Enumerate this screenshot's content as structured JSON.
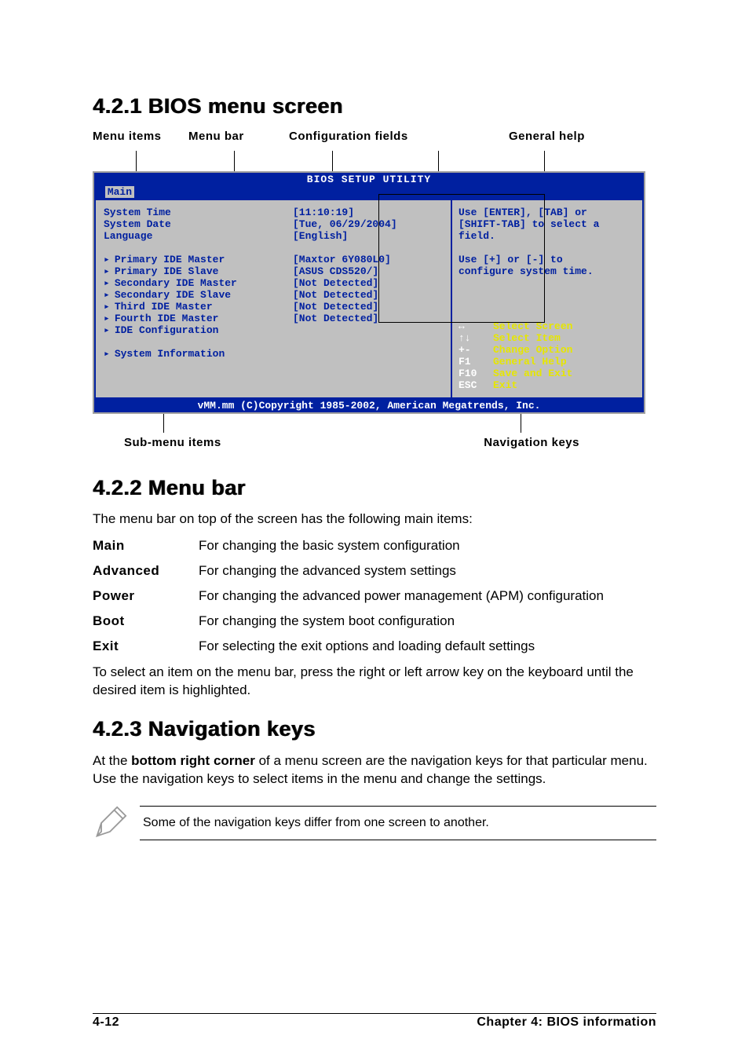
{
  "section1": {
    "heading": "4.2.1   BIOS menu screen"
  },
  "callouts": {
    "menu_items": "Menu items",
    "menu_bar": "Menu bar",
    "config_fields": "Configuration fields",
    "general_help": "General help",
    "submenu_items": "Sub-menu items",
    "nav_keys": "Navigation keys"
  },
  "bios": {
    "title": "BIOS SETUP UTILITY",
    "tab": "Main",
    "left": {
      "l1": "System Time",
      "l2": "System Date",
      "l3": "Language",
      "l4": "Primary IDE Master",
      "l5": "Primary IDE Slave",
      "l6": "Secondary IDE Master",
      "l7": "Secondary IDE Slave",
      "l8": "Third IDE Master",
      "l9": "Fourth IDE Master",
      "l10": "IDE Configuration",
      "l11": "System Information"
    },
    "mid": {
      "m1": "[11:10:19]",
      "m2": "[Tue, 06/29/2004]",
      "m3": "[English]",
      "m4": "[Maxtor 6Y080L0]",
      "m5": "[ASUS CDS520/]",
      "m6": "[Not Detected]",
      "m7": "[Not Detected]",
      "m8": "[Not Detected]",
      "m9": "[Not Detected]"
    },
    "help": {
      "h1": "Use [ENTER], [TAB] or",
      "h2": "[SHIFT-TAB] to select a",
      "h3": "field.",
      "h4": "Use [+] or [-] to",
      "h5": "configure system time."
    },
    "nav": {
      "n1k": "↔",
      "n1": "Select Screen",
      "n2k": "↑↓",
      "n2": "Select Item",
      "n3k": "+-",
      "n3": "Change Option",
      "n4k": "F1",
      "n4": "General Help",
      "n5k": "F10",
      "n5": "Save and Exit",
      "n6k": "ESC",
      "n6": "Exit"
    },
    "footer": "vMM.mm (C)Copyright 1985-2002, American Megatrends, Inc."
  },
  "section2": {
    "heading": "4.2.2   Menu bar",
    "intro": "The menu bar on top of the screen has the following main items:",
    "rows": {
      "r1t": "Main",
      "r1d": "For changing the basic system configuration",
      "r2t": "Advanced",
      "r2d": "For changing the advanced system settings",
      "r3t": "Power",
      "r3d": "For changing the advanced power management (APM) configuration",
      "r4t": "Boot",
      "r4d": "For changing the system boot configuration",
      "r5t": "Exit",
      "r5d": "For selecting the exit options and loading default settings"
    },
    "text": "To select an item on the menu bar, press the right or left arrow key on the keyboard until the desired item is highlighted."
  },
  "section3": {
    "heading": "4.2.3   Navigation keys",
    "text_a": "At the ",
    "text_bold": "bottom right corner",
    "text_b": " of a menu screen are the navigation keys for that particular menu. Use the navigation keys to select items in the menu and change the settings.",
    "note": "Some of the navigation keys differ from one screen to another."
  },
  "footer": {
    "left": "4-12",
    "right": "Chapter 4: BIOS information"
  }
}
